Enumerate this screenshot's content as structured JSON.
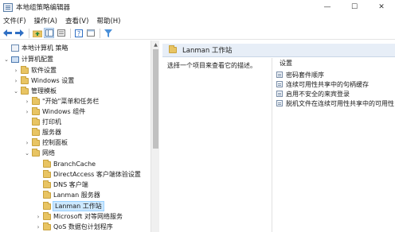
{
  "window": {
    "title": "本地组策略编辑器",
    "controls": {
      "minimize": "—",
      "maximize": "☐",
      "close": "✕"
    }
  },
  "menu": [
    "文件(F)",
    "操作(A)",
    "查看(V)",
    "帮助(H)"
  ],
  "toolbar": [
    "back-icon",
    "forward-icon",
    "up-folder-icon",
    "show-hide-tree-icon",
    "help-icon",
    "properties-icon",
    "filter-icon"
  ],
  "tree": [
    {
      "label": "本地计算机 策略",
      "expander": "",
      "icon": "policy",
      "indent": 0
    },
    {
      "label": "计算机配置",
      "expander": "⌄",
      "icon": "computer",
      "indent": 1
    },
    {
      "label": "软件设置",
      "expander": "›",
      "icon": "folder",
      "indent": 2
    },
    {
      "label": "Windows 设置",
      "expander": "›",
      "icon": "folder",
      "indent": 2
    },
    {
      "label": "管理模板",
      "expander": "⌄",
      "icon": "folder",
      "indent": 2
    },
    {
      "label": "\"开始\"菜单和任务栏",
      "expander": "›",
      "icon": "folder",
      "indent": 3
    },
    {
      "label": "Windows 组件",
      "expander": "›",
      "icon": "folder",
      "indent": 3
    },
    {
      "label": "打印机",
      "expander": "",
      "icon": "folder",
      "indent": 3
    },
    {
      "label": "服务器",
      "expander": "",
      "icon": "folder",
      "indent": 3
    },
    {
      "label": "控制面板",
      "expander": "›",
      "icon": "folder",
      "indent": 3
    },
    {
      "label": "网络",
      "expander": "⌄",
      "icon": "folder",
      "indent": 3
    },
    {
      "label": "BranchCache",
      "expander": "",
      "icon": "folder",
      "indent": 4
    },
    {
      "label": "DirectAccess 客户端体验设置",
      "expander": "",
      "icon": "folder",
      "indent": 4
    },
    {
      "label": "DNS 客户端",
      "expander": "",
      "icon": "folder",
      "indent": 4
    },
    {
      "label": "Lanman 服务器",
      "expander": "",
      "icon": "folder",
      "indent": 4
    },
    {
      "label": "Lanman 工作站",
      "expander": "",
      "icon": "folder",
      "indent": 4,
      "selected": true
    },
    {
      "label": "Microsoft 对等网络服务",
      "expander": "›",
      "icon": "folder",
      "indent": 4
    },
    {
      "label": "QoS 数据包计划程序",
      "expander": "›",
      "icon": "folder",
      "indent": 4
    }
  ],
  "details": {
    "header_title": "Lanman 工作站",
    "description": "选择一个项目来查看它的描述。",
    "settings_heading": "设置",
    "settings": [
      "密码套件顺序",
      "连续可用性共享中的句柄缓存",
      "启用不安全的来宾登录",
      "脱机文件在连续可用性共享中的可用性"
    ]
  },
  "colors": {
    "selection": "#cce8ff",
    "header_band": "#e7eef7",
    "folder": "#e8c463"
  }
}
